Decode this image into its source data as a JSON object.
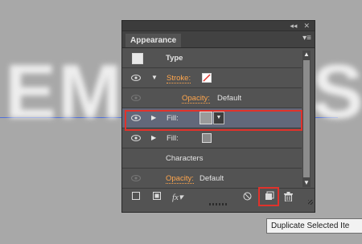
{
  "canvas": {
    "text_left": "EM",
    "text_right": "S"
  },
  "panel": {
    "tab_title": "Appearance",
    "collapse_glyph": "◂◂",
    "close_glyph": "✕",
    "menu_glyph": "▾≡"
  },
  "rows": {
    "type": {
      "label": "Type"
    },
    "stroke": {
      "label": "Stroke:"
    },
    "stroke_opacity": {
      "label": "Opacity:",
      "value": "Default"
    },
    "fill1": {
      "label": "Fill:"
    },
    "fill2": {
      "label": "Fill:"
    },
    "characters": {
      "label": "Characters"
    },
    "char_opacity": {
      "label": "Opacity:",
      "value": "Default"
    }
  },
  "toolbar": {
    "add_stroke": "add-new-stroke-icon",
    "add_fill": "add-new-fill-icon",
    "fx_label": "fx",
    "clear": "clear-appearance-icon",
    "duplicate": "duplicate-item-icon",
    "delete": "delete-icon"
  },
  "tooltip": {
    "text": "Duplicate Selected Ite"
  },
  "colors": {
    "highlight": "#e0322b",
    "orange_link": "#ffa64d",
    "selected_row": "#62687a"
  }
}
